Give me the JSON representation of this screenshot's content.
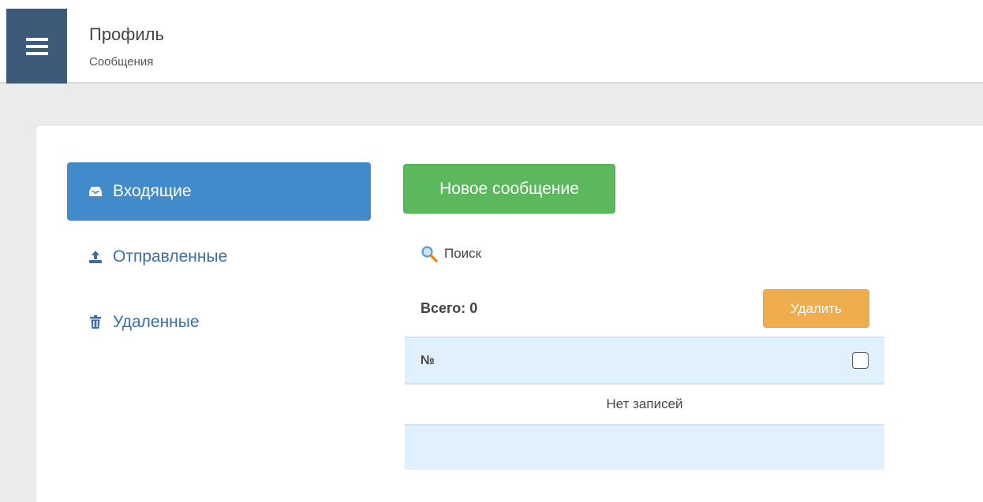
{
  "header": {
    "title": "Профиль",
    "subtitle": "Сообщения",
    "menu_icon": "hamburger-icon"
  },
  "sidebar": {
    "items": [
      {
        "label": "Входящие",
        "icon": "inbox-icon",
        "active": true
      },
      {
        "label": "Отправленные",
        "icon": "upload-icon",
        "active": false
      },
      {
        "label": "Удаленные",
        "icon": "trash-icon",
        "active": false
      }
    ]
  },
  "main": {
    "new_message_label": "Новое сообщение",
    "search_label": "Поиск",
    "total_label": "Всего: 0",
    "delete_label": "Удалить",
    "table": {
      "column_number": "№",
      "empty_text": "Нет записей"
    }
  },
  "colors": {
    "menu_bg": "#3d5a78",
    "active_nav": "#428bca",
    "new_btn": "#5cb85c",
    "delete_btn": "#f0ad4e",
    "table_head": "#e0f0fd"
  }
}
